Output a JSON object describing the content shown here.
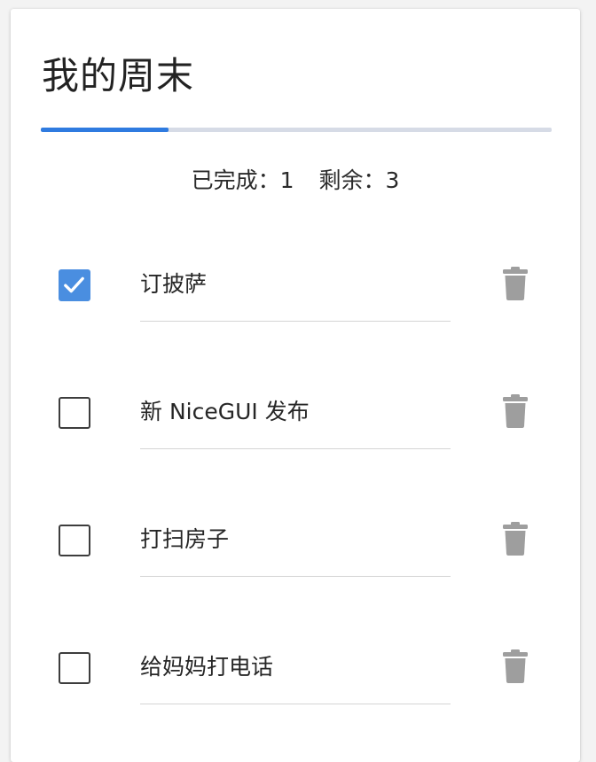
{
  "title": "我的周末",
  "progress": {
    "completed_fraction": 0.25,
    "fill_color": "#2f7be0",
    "track_color": "#d6dbe6"
  },
  "stats": {
    "completed_label": "已完成：",
    "completed_count": "1",
    "remaining_label": "剩余：",
    "remaining_count": "3"
  },
  "todos": [
    {
      "text": "订披萨",
      "done": true,
      "delete_icon": "trash-icon"
    },
    {
      "text": "新 NiceGUI 发布",
      "done": false,
      "delete_icon": "trash-icon"
    },
    {
      "text": "打扫房子",
      "done": false,
      "delete_icon": "trash-icon"
    },
    {
      "text": "给妈妈打电话",
      "done": false,
      "delete_icon": "trash-icon"
    }
  ],
  "colors": {
    "checkbox_checked": "#4a8ee0",
    "trash_icon": "#9e9e9e"
  }
}
